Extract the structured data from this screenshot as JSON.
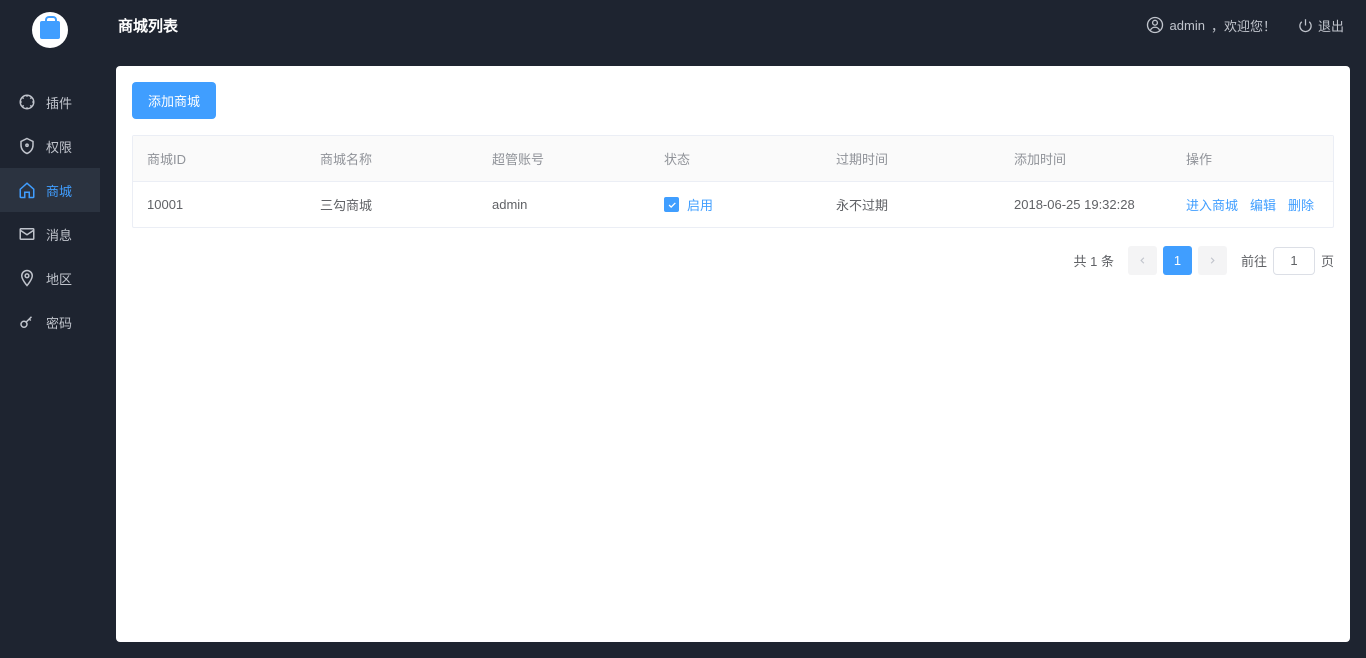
{
  "header": {
    "title": "商城列表",
    "user_prefix": "admin",
    "user_suffix": "，欢迎您！",
    "logout": "退出"
  },
  "sidebar": {
    "items": [
      {
        "label": "插件"
      },
      {
        "label": "权限"
      },
      {
        "label": "商城"
      },
      {
        "label": "消息"
      },
      {
        "label": "地区"
      },
      {
        "label": "密码"
      }
    ]
  },
  "actions": {
    "add": "添加商城"
  },
  "table": {
    "headers": {
      "id": "商城ID",
      "name": "商城名称",
      "account": "超管账号",
      "status": "状态",
      "expire": "过期时间",
      "create": "添加时间",
      "action": "操作"
    },
    "rows": [
      {
        "id": "10001",
        "name": "三勾商城",
        "account": "admin",
        "status": "启用",
        "expire": "永不过期",
        "create": "2018-06-25 19:32:28",
        "actions": {
          "enter": "进入商城",
          "edit": "编辑",
          "delete": "删除"
        }
      }
    ]
  },
  "pagination": {
    "total_text": "共 1 条",
    "current": "1",
    "goto_prefix": "前往",
    "goto_value": "1",
    "goto_suffix": "页"
  }
}
